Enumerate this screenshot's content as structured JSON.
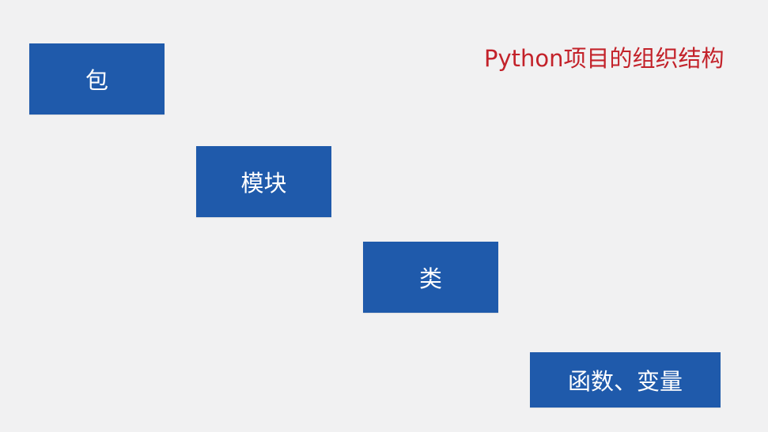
{
  "title": "Python项目的组织结构",
  "levels": [
    {
      "label": "包"
    },
    {
      "label": "模块"
    },
    {
      "label": "类"
    },
    {
      "label": "函数、变量"
    }
  ],
  "colors": {
    "background": "#f1f1f2",
    "box_fill": "#1f5aab",
    "box_text": "#ffffff",
    "title": "#c3222a"
  }
}
